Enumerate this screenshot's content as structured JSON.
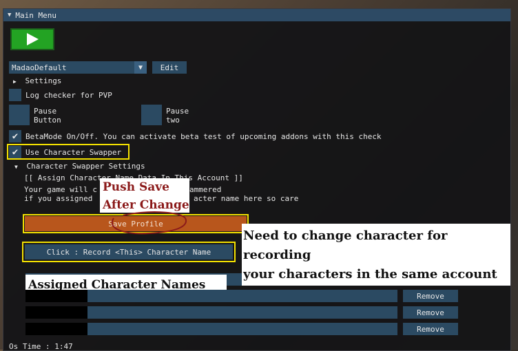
{
  "window": {
    "title": "Main Menu"
  },
  "toolbar": {
    "play_icon": "play-icon"
  },
  "profile": {
    "selected": "MadaoDefault",
    "edit_label": "Edit"
  },
  "settings": {
    "label": "Settings"
  },
  "log_checker": {
    "label": "Log checker for PVP"
  },
  "pause_button": {
    "line1": "Pause",
    "line2": "Button"
  },
  "pause_two": {
    "line1": "Pause",
    "line2": "two"
  },
  "beta_mode": {
    "label": "BetaMode On/Off.  You can activate beta test of upcoming addons with this check"
  },
  "character_swapper": {
    "label": "Use Character Swapper"
  },
  "swapper_settings": {
    "header": "Character Swapper Settings",
    "assign_line": "[[ Assign Character Name Data In This Account ]]",
    "info_line1": "Your game will c",
    "info_line1_end": "ammered",
    "info_line2": "if you assigned ",
    "info_line2_end": "acter name here so care"
  },
  "annotations": {
    "push_save": "Push Save",
    "after_change": "After Change",
    "need_change_1": "Need to change character for recording",
    "need_change_2": "your characters in the same account",
    "assigned_names": "Assigned Character Names"
  },
  "save_profile": {
    "label": "Save Profile"
  },
  "record_button": {
    "label": "Click : Record <This> Character Name"
  },
  "assigned_rows": [
    {
      "remove_label": "Remove"
    },
    {
      "remove_label": "Remove"
    },
    {
      "remove_label": "Remove"
    }
  ],
  "status": {
    "os_time": "Os Time : 1:47"
  },
  "colors": {
    "panel": "#2b4a62",
    "highlight": "#f4e200",
    "save": "#b8561c",
    "annotation_red": "#8b1a1a"
  }
}
